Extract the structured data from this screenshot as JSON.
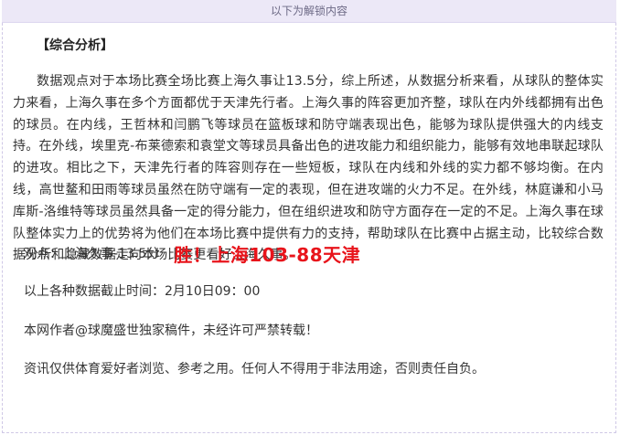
{
  "banner": {
    "text": "以下为解锁内容"
  },
  "article": {
    "section_title": "【综合分析】",
    "paragraph": "数据观点对于本场比赛全场比赛上海久事让13.5分，综上所述，从数据分析来看，从球队的整体实力来看，上海久事在多个方面都优于天津先行者。上海久事的阵容更加齐整，球队在内外线都拥有出色的球员。在内线，王哲林和闫鹏飞等球员在篮板球和防守端表现出色，能够为球队提供强大的内线支持。在外线，埃里克-布莱德索和袁堂文等球员具备出色的进攻能力和组织能力，能够有效地串联起球队的进攻。相比之下，天津先行者的阵容则存在一些短板，球队在内线和外线的实力都不够均衡。在内线，高世鳌和田雨等球员虽然在防守端有一定的表现，但在进攻端的火力不足。在外线，林庭谦和小马库斯-洛维特等球员虽然具备一定的得分能力，但在组织进攻和防守方面存在一定的不足。上海久事在球队整体实力上的优势将为他们在本场比赛中提供有力的支持，帮助球队在比赛中占据主动，比较综合数据分析和隐藏数据走向本场比赛更看好上海久事。",
    "viewpoint_label": "观点：上海久事-13.5分",
    "viewpoint_result": "胜！上海103-88天津",
    "deadline": "以上各种数据截止时间：2月10日09：00",
    "author_note": "本网作者@球魔盛世独家稿件，未经许可严禁转载！",
    "disclaimer": "资讯仅供体育爱好者浏览、参考之用。任何人不得用于非法用途，否则责任自负。"
  },
  "colors": {
    "result_red": "#e8141b",
    "banner_bg": "#ece8f7"
  }
}
